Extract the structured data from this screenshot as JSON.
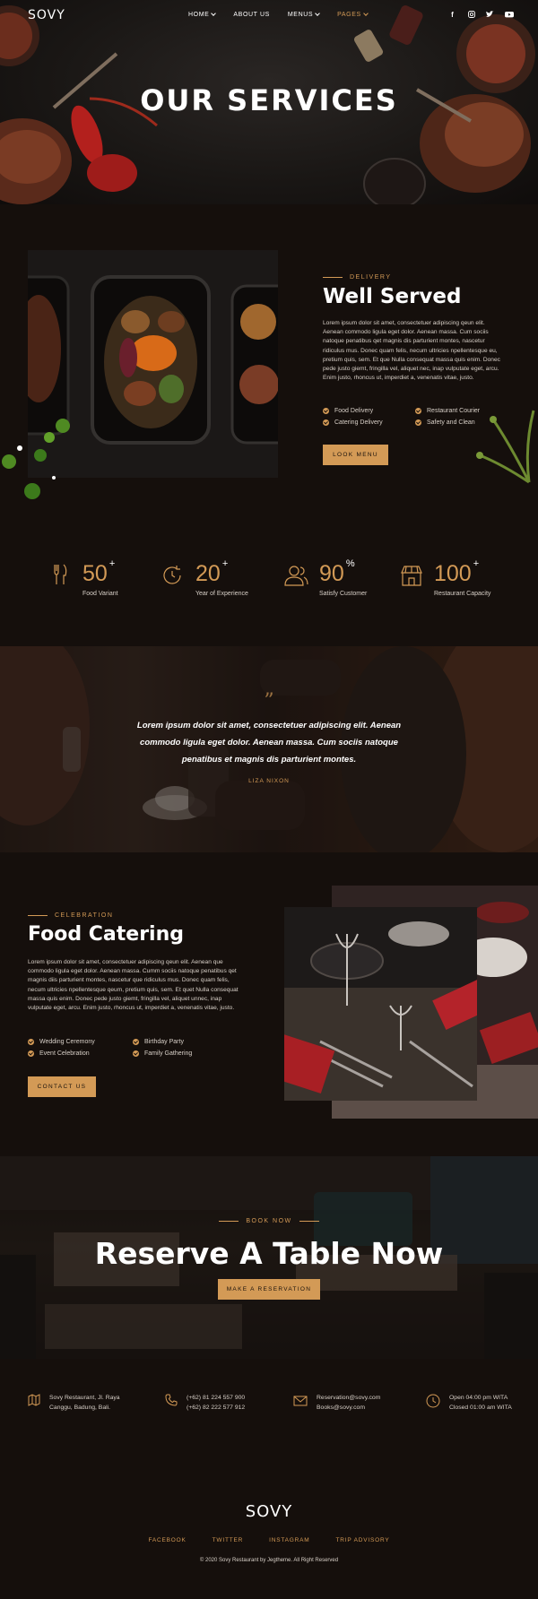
{
  "brand": "SOVY",
  "nav": {
    "items": [
      {
        "label": "HOME",
        "dropdown": true,
        "active": false
      },
      {
        "label": "ABOUT US",
        "dropdown": false,
        "active": false
      },
      {
        "label": "MENUS",
        "dropdown": true,
        "active": false
      },
      {
        "label": "PAGES",
        "dropdown": true,
        "active": true
      }
    ],
    "social_icons": [
      "facebook-icon",
      "instagram-icon",
      "twitter-icon",
      "youtube-icon"
    ]
  },
  "hero": {
    "title": "OUR SERVICES"
  },
  "delivery": {
    "eyebrow": "DELIVERY",
    "title": "Well Served",
    "paragraph": "Lorem ipsum dolor sit amet, consectetuer adipiscing qeun elit. Aenean commodo ligula eget dolor. Aenean massa. Cum sociis natoque penatibus qet magnis dis parturient montes, nascetur ridiculus mus. Donec quam felis, necum ultricies npellentesque eu, pretium quis, sem. Et que Nulla consequat massa quis enim. Donec pede justo giemt, fringilla vel, aliquet nec, inap vulputate eget, arcu. Enim justo, rhoncus ut, imperdiet a, venenatis vitae, justo.",
    "features": [
      "Food Delivery",
      "Restaurant Courier",
      "Catering Delivery",
      "Safety and Clean"
    ],
    "button": "LOOK MENU"
  },
  "stats": [
    {
      "value": "50",
      "suffix": "+",
      "label": "Food Variant",
      "icon": "cutlery-icon"
    },
    {
      "value": "20",
      "suffix": "+",
      "label": "Year of Experience",
      "icon": "history-icon"
    },
    {
      "value": "90",
      "suffix": "%",
      "label": "Satisfy Customer",
      "icon": "users-icon"
    },
    {
      "value": "100",
      "suffix": "+",
      "label": "Restaurant Capacity",
      "icon": "store-icon"
    }
  ],
  "testimonial": {
    "quote": "Lorem ipsum dolor sit amet, consectetuer adipiscing elit. Aenean commodo ligula eget dolor. Aenean massa. Cum sociis natoque penatibus et magnis dis parturient montes.",
    "author": "LIZA NIXON"
  },
  "catering": {
    "eyebrow": "CELEBRATION",
    "title": "Food Catering",
    "paragraph": "Lorem ipsum dolor sit amet, consectetuer adipiscing qeun elit. Aenean que commodo ligula eget dolor. Aenean massa. Cumm sociis natoque penatibus qet magnis diis parturient montes, nascetur que ridiculus mus. Donec quam felis, necum ultricies npellentesque qeum, pretium quis, sem. Et quet Nulla consequat massa quis enim. Donec pede justo giemt, fringilla vel, aliquet unnec, inap vulputate eget, arcu. Enim justo, rhoncus ut, imperdiet a, venenatis vitae, justo.",
    "features": [
      "Wedding Ceremony",
      "Birthday Party",
      "Event Celebration",
      "Family Gathering"
    ],
    "button": "CONTACT US"
  },
  "reserve": {
    "eyebrow": "BOOK NOW",
    "title": "Reserve A Table Now",
    "button": "MAKE A RESERVATION"
  },
  "footer": {
    "info": [
      {
        "icon": "map-icon",
        "lines": [
          "Sovy Restaurant, Jl. Raya",
          "Canggu, Badung, Bali."
        ]
      },
      {
        "icon": "phone-icon",
        "lines": [
          "(+62) 81 224 557 900",
          "(+62) 82 222 577 912"
        ]
      },
      {
        "icon": "mail-icon",
        "lines": [
          "Reservation@sovy.com",
          "Books@sovy.com"
        ]
      },
      {
        "icon": "clock-icon",
        "lines": [
          "Open 04:00 pm WITA",
          "Closed 01:00 am WITA"
        ]
      }
    ],
    "brand": "SOVY",
    "links": [
      "FACEBOOK",
      "TWITTER",
      "INSTAGRAM",
      "TRIP ADVISORY"
    ],
    "copyright": "© 2020 Sovy Restaurant by Jegtheme. All Right Reserved"
  },
  "colors": {
    "accent": "#d39a56",
    "background": "#150f0c",
    "text": "#d8d0c8",
    "heading": "#ffffff"
  }
}
